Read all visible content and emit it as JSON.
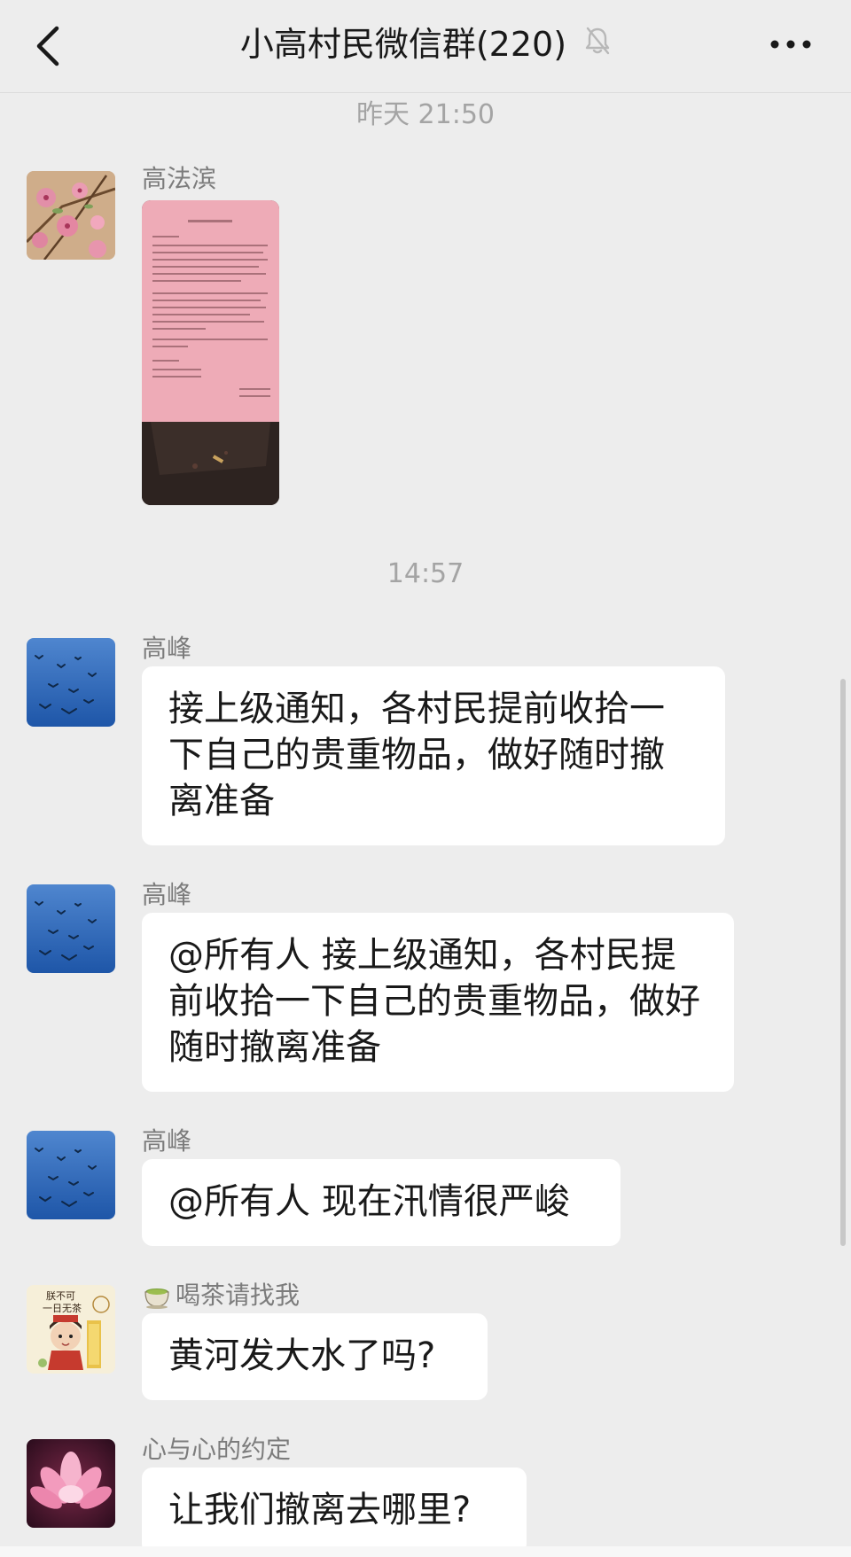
{
  "header": {
    "title": "小高村民微信群(220)",
    "back_icon": "chevron-left-icon",
    "mute_icon": "bell-off-icon",
    "more_icon": "more-dots-icon"
  },
  "timestamps": [
    "昨天 21:50",
    "14:57"
  ],
  "messages": [
    {
      "sender": "高法滨",
      "type": "image",
      "avatar": "peach-blossom-avatar"
    },
    {
      "sender": "高峰",
      "type": "text",
      "text": "接上级通知，各村民提前收拾一下自己的贵重物品，做好随时撤离准备",
      "avatar": "birds-sky-avatar"
    },
    {
      "sender": "高峰",
      "type": "text",
      "text": "@所有人 接上级通知，各村民提前收拾一下自己的贵重物品，做好随时撤离准备",
      "avatar": "birds-sky-avatar"
    },
    {
      "sender": "高峰",
      "type": "text",
      "text": "@所有人 现在汛情很严峻",
      "avatar": "birds-sky-avatar"
    },
    {
      "sender": "喝茶请找我",
      "type": "text",
      "text": "黄河发大水了吗?",
      "avatar": "tea-cartoon-avatar",
      "name_prefix_icon": "tea-cup-icon",
      "avatar_text_1": "朕不可",
      "avatar_text_2": "一日无茶"
    },
    {
      "sender": "心与心的约定",
      "type": "text",
      "text": "让我们撤离去哪里?",
      "avatar": "lotus-avatar"
    }
  ],
  "colors": {
    "background": "#ededed",
    "bubble": "#ffffff",
    "timestamp": "#a4a4a4",
    "sender": "#7c7c7c"
  }
}
